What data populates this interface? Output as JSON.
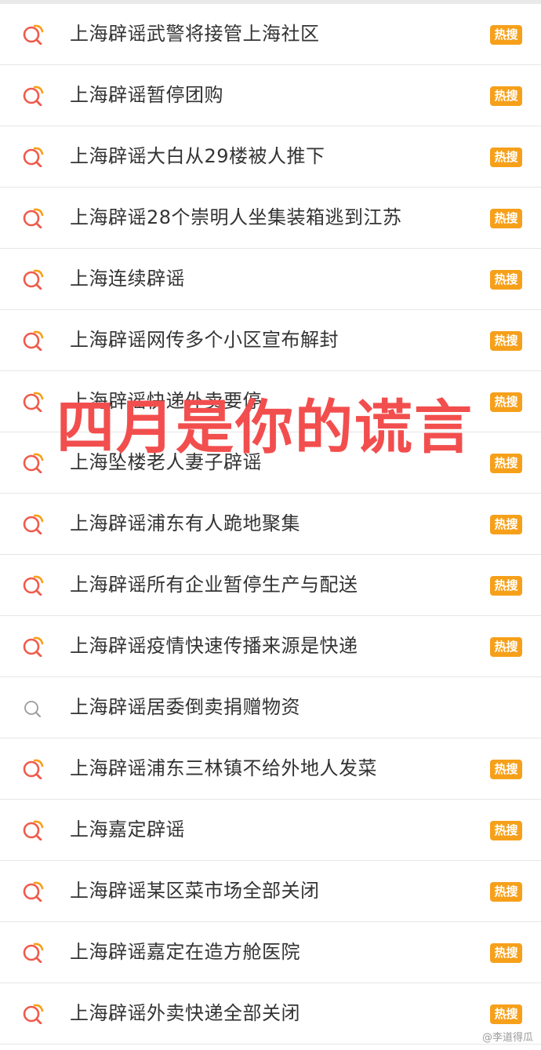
{
  "badge_label": "热搜",
  "badge_color": "#f6a01a",
  "icon_colors": {
    "hot": "#f05a4a",
    "hot_accent": "#f6a01a",
    "plain": "#9a9a9a"
  },
  "items": [
    {
      "text": "上海辟谣武警将接管上海社区",
      "hot": true
    },
    {
      "text": "上海辟谣暂停团购",
      "hot": true
    },
    {
      "text": "上海辟谣大白从29楼被人推下",
      "hot": true
    },
    {
      "text": "上海辟谣28个崇明人坐集装箱逃到江苏",
      "hot": true
    },
    {
      "text": "上海连续辟谣",
      "hot": true
    },
    {
      "text": "上海辟谣网传多个小区宣布解封",
      "hot": true
    },
    {
      "text": "上海辟谣快递外卖要停",
      "hot": true
    },
    {
      "text": "上海坠楼老人妻子辟谣",
      "hot": true
    },
    {
      "text": "上海辟谣浦东有人跪地聚集",
      "hot": true
    },
    {
      "text": "上海辟谣所有企业暂停生产与配送",
      "hot": true
    },
    {
      "text": "上海辟谣疫情快速传播来源是快递",
      "hot": true
    },
    {
      "text": "上海辟谣居委倒卖捐赠物资",
      "hot": false
    },
    {
      "text": "上海辟谣浦东三林镇不给外地人发菜",
      "hot": true
    },
    {
      "text": "上海嘉定辟谣",
      "hot": true
    },
    {
      "text": "上海辟谣某区菜市场全部关闭",
      "hot": true
    },
    {
      "text": "上海辟谣嘉定在造方舱医院",
      "hot": true
    },
    {
      "text": "上海辟谣外卖快递全部关闭",
      "hot": true
    }
  ],
  "overlay_text": "四月是你的谎言",
  "watermark": "@李道得瓜"
}
